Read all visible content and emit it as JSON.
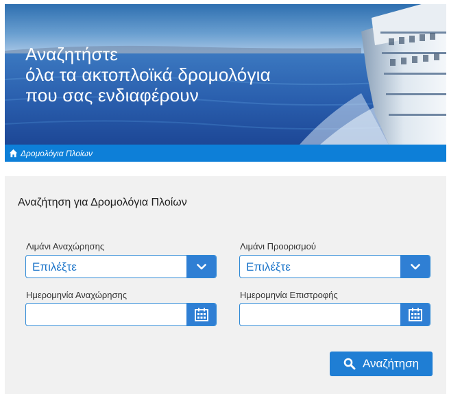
{
  "banner": {
    "headline_lines": [
      "Αναζητήστε",
      "όλα τα ακτοπλοϊκά δρομολόγια",
      "που σας ενδιαφέρουν"
    ],
    "breadcrumb": "Δρομολόγια Πλοίων",
    "breadcrumb_icon": "home-icon",
    "bar_color": "#0d7fd8"
  },
  "search": {
    "title": "Αναζήτηση για Δρομολόγια Πλοίων",
    "departure_port": {
      "label": "Λιμάνι Αναχώρησης",
      "value": "Επιλέξτε",
      "icon": "chevron-down-icon"
    },
    "destination_port": {
      "label": "Λιμάνι Προορισμού",
      "value": "Επιλέξτε",
      "icon": "chevron-down-icon"
    },
    "departure_date": {
      "label": "Ημερομηνία Αναχώρησης",
      "value": "",
      "icon": "calendar-icon"
    },
    "return_date": {
      "label": "Ημερομηνία Επιστροφής",
      "value": "",
      "icon": "calendar-icon"
    },
    "button_label": "Αναζήτηση",
    "button_icon": "search-icon",
    "accent_color": "#1f7ed4"
  }
}
